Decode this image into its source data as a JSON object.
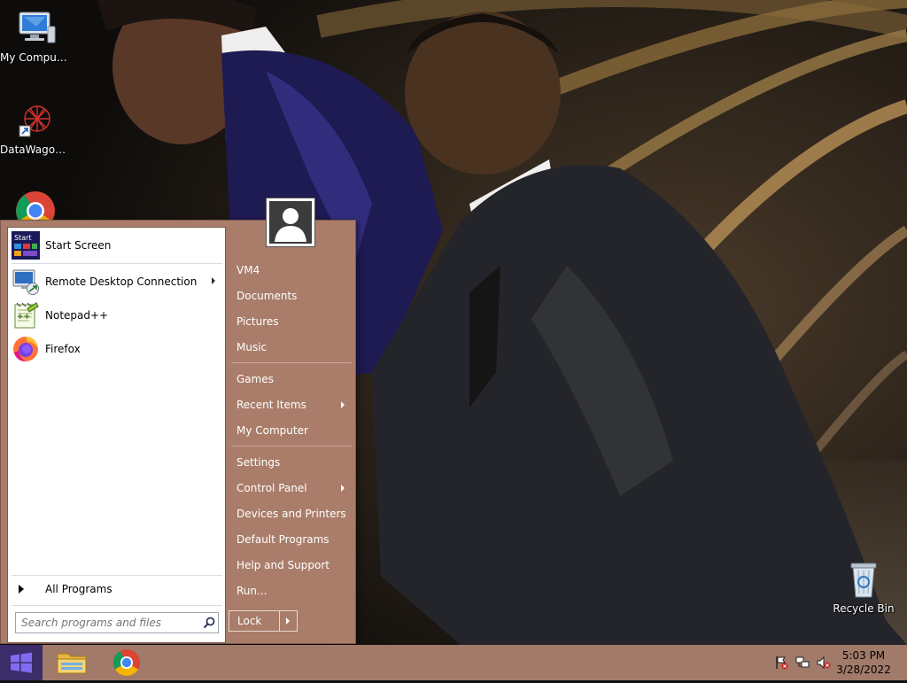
{
  "desktop": {
    "icons": [
      {
        "label": "My Computer",
        "icon": "computer-icon"
      },
      {
        "label": "DataWagon...",
        "icon": "datawagon-shortcut-icon"
      },
      {
        "label": "",
        "icon": "chrome-icon"
      },
      {
        "label": "Recycle Bin",
        "icon": "recycle-bin-icon"
      }
    ]
  },
  "start_menu": {
    "pinned": [
      {
        "label": "Start Screen",
        "icon": "start-screen-icon",
        "submenu": false
      },
      {
        "label": "Remote Desktop Connection",
        "icon": "remote-desktop-icon",
        "submenu": true
      },
      {
        "label": "Notepad++",
        "icon": "notepadpp-icon",
        "submenu": false
      },
      {
        "label": "Firefox",
        "icon": "firefox-icon",
        "submenu": false
      }
    ],
    "start_screen_badge": "Start",
    "all_programs": "All Programs",
    "search_placeholder": "Search programs and files",
    "right_items": [
      {
        "label": "VM4",
        "submenu": false
      },
      {
        "label": "Documents",
        "submenu": false
      },
      {
        "label": "Pictures",
        "submenu": false
      },
      {
        "label": "Music",
        "submenu": false
      },
      {
        "label": "Games",
        "submenu": false
      },
      {
        "label": "Recent Items",
        "submenu": true
      },
      {
        "label": "My Computer",
        "submenu": false
      },
      {
        "label": "Settings",
        "submenu": false
      },
      {
        "label": "Control Panel",
        "submenu": true
      },
      {
        "label": "Devices and Printers",
        "submenu": false
      },
      {
        "label": "Default Programs",
        "submenu": false
      },
      {
        "label": "Help and Support",
        "submenu": false
      },
      {
        "label": "Run...",
        "submenu": false
      }
    ],
    "lock_label": "Lock",
    "colors": {
      "menu_bg": "#a97d6a",
      "taskbar_bg": "#a17a69"
    }
  },
  "taskbar": {
    "apps": [
      "file-explorer-icon",
      "chrome-icon"
    ],
    "tray_icons": [
      "action-center-flag-icon",
      "network-icon",
      "volume-muted-icon"
    ],
    "clock_time": "5:03 PM",
    "clock_date": "3/28/2022"
  }
}
